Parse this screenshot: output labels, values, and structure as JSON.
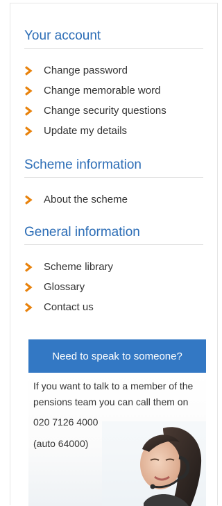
{
  "sections": [
    {
      "title": "Your account",
      "links": [
        {
          "label": "Change password"
        },
        {
          "label": "Change memorable word"
        },
        {
          "label": "Change security questions"
        },
        {
          "label": "Update my details"
        }
      ]
    },
    {
      "title": "Scheme information",
      "links": [
        {
          "label": "About the scheme"
        }
      ]
    },
    {
      "title": "General information",
      "links": [
        {
          "label": "Scheme library"
        },
        {
          "label": "Glossary"
        },
        {
          "label": "Contact us"
        }
      ]
    }
  ],
  "callout": {
    "heading": "Need to speak to someone?",
    "text": "If you want to talk to a member of the pensions team you can call them on",
    "phone": "020 7126 4000",
    "extension": "(auto 64000)"
  },
  "colors": {
    "accent": "#2c6db6",
    "chevron": "#e8820c",
    "callout_header": "#3378c4"
  },
  "icons": {
    "link_bullet": "chevron-right-icon",
    "callout_image": "support-agent-photo"
  }
}
